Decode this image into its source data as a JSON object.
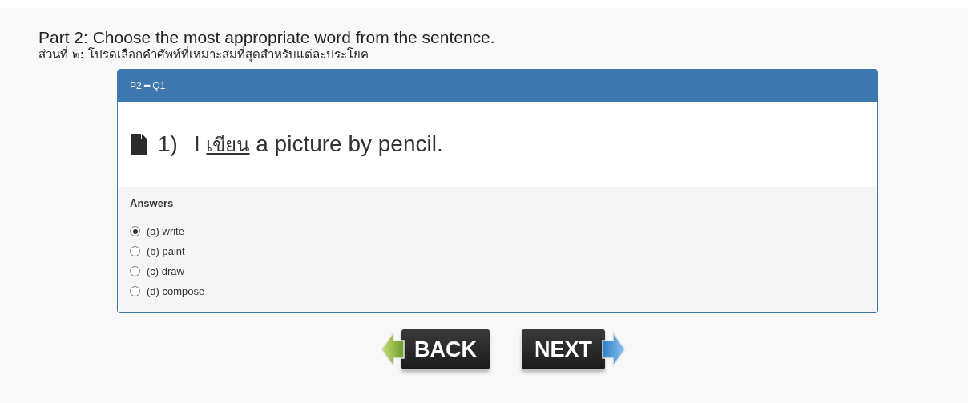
{
  "instructions": {
    "title": "Part 2: Choose the most appropriate word from the sentence.",
    "subtitle": "ส่วนที่ ๒: โปรดเลือกคำศัพท์ที่เหมาะสมที่สุดสำหรับแต่ละประโยค"
  },
  "panel": {
    "heading": "P2 ━ Q1",
    "question": {
      "number": "1)",
      "before": "I",
      "underlined": "เขียน",
      "after": "a picture by pencil."
    },
    "answers_label": "Answers",
    "answers": [
      {
        "label": "(a) write",
        "selected": true
      },
      {
        "label": "(b) paint",
        "selected": false
      },
      {
        "label": "(c) draw",
        "selected": false
      },
      {
        "label": "(d) compose",
        "selected": false
      }
    ]
  },
  "buttons": [
    {
      "kind": "back",
      "label": "BACK"
    },
    {
      "kind": "next",
      "label": "NEXT"
    }
  ]
}
